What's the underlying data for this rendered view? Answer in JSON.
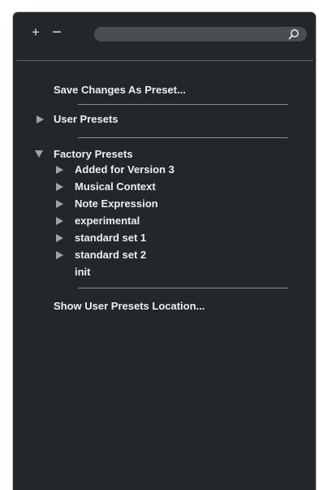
{
  "toolbar": {
    "add_label": "+",
    "remove_label": "−",
    "search_placeholder": "",
    "search_value": ""
  },
  "menu": {
    "save_changes": "Save Changes As Preset...",
    "user_presets": "User Presets",
    "factory_presets": "Factory Presets",
    "factory_items": [
      "Added for Version 3",
      "Musical Context",
      "Note Expression",
      "experimental",
      "standard set 1",
      "standard set 2",
      "init"
    ],
    "show_location": "Show User Presets Location..."
  },
  "colors": {
    "panel_bg": "#24272a",
    "text": "#eceef0",
    "arrow": "#9ea3a8",
    "search_bg": "#4a4e53"
  }
}
